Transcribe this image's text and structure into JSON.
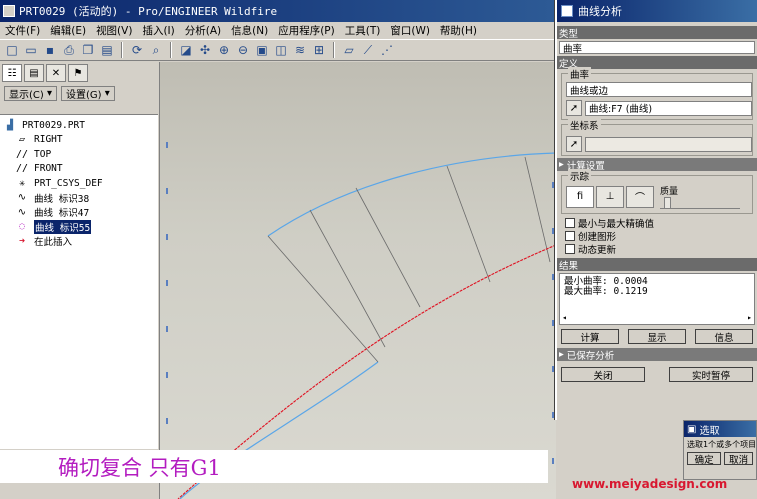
{
  "window": {
    "title": "PRT0029 (活动的) - Pro/ENGINEER Wildfire"
  },
  "menu": [
    "文件(F)",
    "编辑(E)",
    "视图(V)",
    "插入(I)",
    "分析(A)",
    "信息(N)",
    "应用程序(P)",
    "工具(T)",
    "窗口(W)",
    "帮助(H)"
  ],
  "toolbar_icons": [
    "new-icon",
    "open-icon",
    "save-icon",
    "print-icon",
    "copy-icon",
    "paste-icon",
    "regen-icon",
    "find-icon",
    "repaint-icon",
    "zoom-in-icon",
    "zoom-out-icon",
    "refit-icon",
    "orient-icon",
    "view-manager-icon",
    "layer-icon",
    "datum-plane-icon",
    "datum-axis-icon",
    "datum-point-icon",
    "csys-icon"
  ],
  "left_panel": {
    "display_dropdown": "显示(C)",
    "settings_dropdown": "设置(G)",
    "tree": [
      {
        "label": "PRT0029.PRT",
        "icon": "part-icon",
        "root": true,
        "selected": false
      },
      {
        "label": "RIGHT",
        "icon": "datum-plane-icon",
        "root": false,
        "selected": false
      },
      {
        "label": "TOP",
        "icon": "datum-plane-icon",
        "root": false,
        "selected": false
      },
      {
        "label": "FRONT",
        "icon": "datum-plane-icon",
        "root": false,
        "selected": false
      },
      {
        "label": "PRT_CSYS_DEF",
        "icon": "csys-icon",
        "root": false,
        "selected": false
      },
      {
        "label": "曲线 标识38",
        "icon": "curve-icon",
        "root": false,
        "selected": false
      },
      {
        "label": "曲线 标识47",
        "icon": "curve-icon",
        "root": false,
        "selected": false
      },
      {
        "label": "曲线 标识55",
        "icon": "curve-icon",
        "root": false,
        "selected": true
      },
      {
        "label": "在此插入",
        "icon": "insert-arrow-icon",
        "root": false,
        "selected": false
      }
    ]
  },
  "caption": "确切复合    只有G1",
  "dialog": {
    "title": "曲线分析",
    "type_section": "类型",
    "type_value": "曲率",
    "definition_section": "定义",
    "curve_group_label": "曲率",
    "curve_type_value": "曲线或边",
    "curve_select_value": "曲线:F7 (曲线)",
    "csys_group_label": "坐标系",
    "csys_value": "",
    "compute_section": "计算设置",
    "density_label": "示踪",
    "quality_label": "质量",
    "checkboxes": [
      "最小与最大精确值",
      "创建图形",
      "动态更新"
    ],
    "results_section": "结果",
    "results_lines": [
      "最小曲率: 0.0004",
      "最大曲率: 0.1219"
    ],
    "buttons": {
      "compute": "计算",
      "display": "显示",
      "info": "信息"
    },
    "saved_section": "已保存分析",
    "bottom_buttons": {
      "close": "关闭",
      "repeat": "实时暂停"
    }
  },
  "select_box": {
    "title": "选取",
    "text": "选取1个或多个项目",
    "ok": "确定",
    "cancel": "取消"
  },
  "watermark": "www.meiyadesign.com",
  "colors": {
    "curve_blue": "#5aa6e8",
    "curve_red": "#e01020",
    "caption_text": "#b31cc0",
    "title_bar": "#0a246a"
  }
}
